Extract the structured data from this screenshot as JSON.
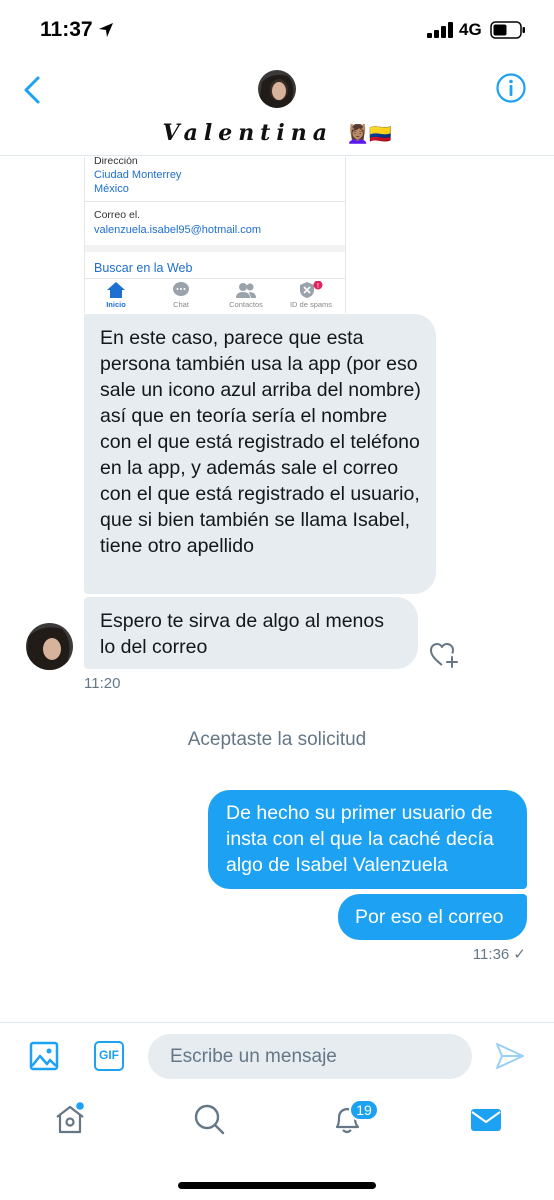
{
  "status_bar": {
    "time": "11:37",
    "network": "4G"
  },
  "header": {
    "contact_name": "Valentina",
    "contact_emojis": "💆🏽‍♀️🇨🇴"
  },
  "shared_screenshot": {
    "address_label": "Dirección",
    "address_line1": "Ciudad Monterrey",
    "address_line2": "México",
    "email_label": "Correo el.",
    "email_value": "valenzuela.isabel95@hotmail.com",
    "web_search": "Buscar en la Web",
    "tabs": [
      {
        "label": "Inicio",
        "icon": "home-icon"
      },
      {
        "label": "Chat",
        "icon": "chat-icon"
      },
      {
        "label": "Contactos",
        "icon": "contacts-icon"
      },
      {
        "label": "ID de spams",
        "icon": "spam-shield-icon",
        "badge": "!"
      }
    ]
  },
  "messages": [
    {
      "direction": "in",
      "text": "En este caso, parece que esta persona también usa la app (por eso sale un icono azul arriba del nombre) así que en teoría sería el nombre con el que está registrado el teléfono en la app, y además sale el correo con el que está registrado el usuario, que si bien también se llama Isabel, tiene otro apellido"
    },
    {
      "direction": "in",
      "text": "Espero te sirva de algo al menos lo del correo",
      "time": "11:20"
    },
    {
      "direction": "system",
      "text": "Aceptaste la solicitud"
    },
    {
      "direction": "out",
      "text": "De hecho su primer usuario de insta con el que la caché decía algo de Isabel Valenzuela"
    },
    {
      "direction": "out",
      "text": "Por eso el correo",
      "time": "11:36 ✓"
    }
  ],
  "compose": {
    "gif_label": "GIF",
    "placeholder": "Escribe un mensaje"
  },
  "tabbar": {
    "notifications_count": "19"
  },
  "colors": {
    "accent": "#1da1f2",
    "incoming_bubble": "#e6ecf0",
    "muted_text": "#657786"
  }
}
